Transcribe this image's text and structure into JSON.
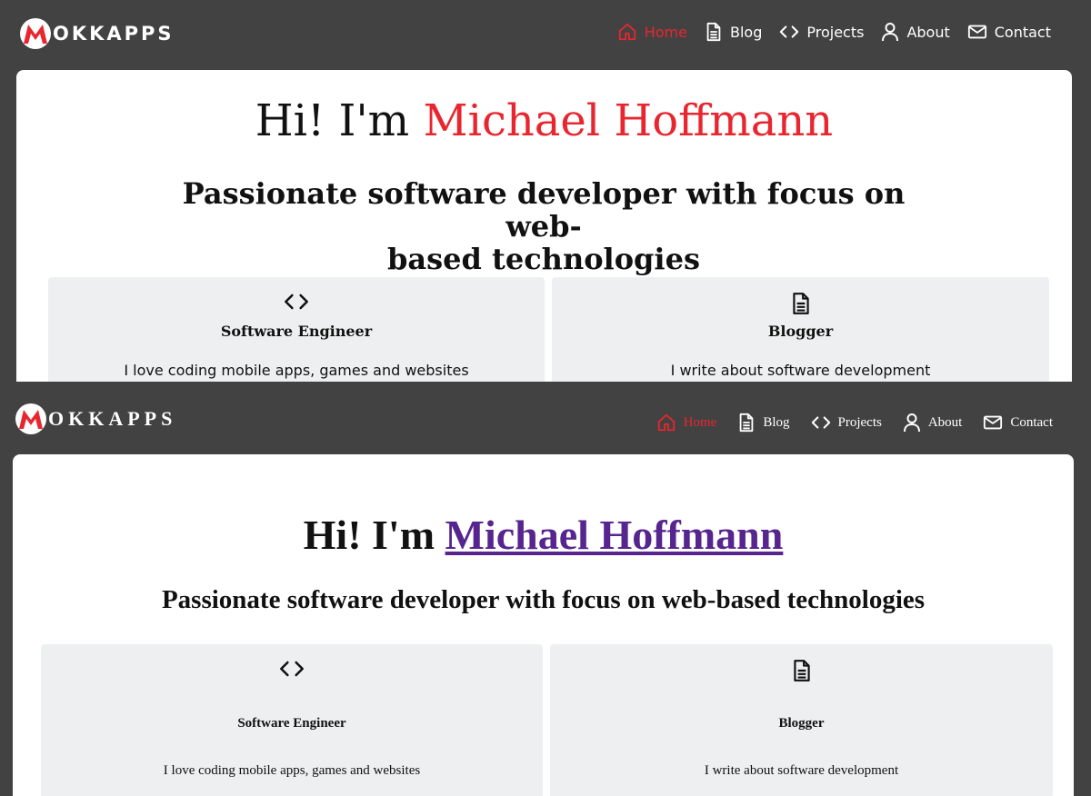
{
  "colors": {
    "nav_bg": "#424242",
    "accent_red": "#e8262f",
    "link_visited": "#57258f",
    "tile_bg": "#edeff0"
  },
  "brand": {
    "logo_letter": "M",
    "logo_text": "OKKAPPS"
  },
  "nav": {
    "items": [
      {
        "label": "Home",
        "icon": "home-icon",
        "active": true
      },
      {
        "label": "Blog",
        "icon": "document-icon",
        "active": false
      },
      {
        "label": "Projects",
        "icon": "code-icon",
        "active": false
      },
      {
        "label": "About",
        "icon": "user-icon",
        "active": false
      },
      {
        "label": "Contact",
        "icon": "mail-icon",
        "active": false
      }
    ]
  },
  "hero": {
    "greeting": "Hi! I'm",
    "name": "Michael Hoffmann",
    "subtitle_line1": "Passionate software developer with focus on web-",
    "subtitle_line2": "based technologies",
    "subtitle_full": "Passionate software developer with focus on web-based technologies"
  },
  "tiles": [
    {
      "icon": "code-icon",
      "title": "Software Engineer",
      "text": "I love coding mobile apps, games and websites"
    },
    {
      "icon": "document-icon",
      "title": "Blogger",
      "text": "I write about software development"
    }
  ]
}
